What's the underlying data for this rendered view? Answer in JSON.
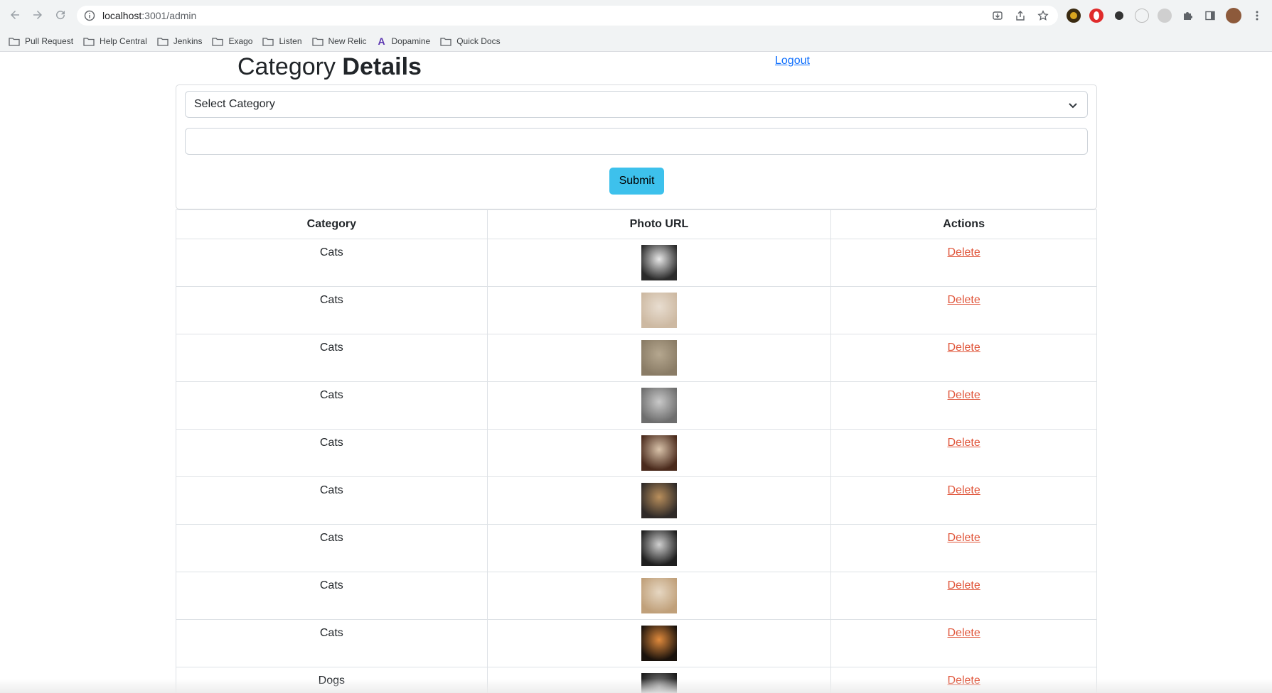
{
  "browser": {
    "url_host": "localhost",
    "url_path": ":3001/admin",
    "bookmarks": [
      {
        "label": "Pull Request",
        "icon": "folder-icon"
      },
      {
        "label": "Help Central",
        "icon": "folder-icon"
      },
      {
        "label": "Jenkins",
        "icon": "folder-icon"
      },
      {
        "label": "Exago",
        "icon": "folder-icon"
      },
      {
        "label": "Listen",
        "icon": "folder-icon"
      },
      {
        "label": "New Relic",
        "icon": "folder-icon"
      },
      {
        "label": "Dopamine",
        "icon": "a-logo-icon"
      },
      {
        "label": "Quick Docs",
        "icon": "folder-icon"
      }
    ]
  },
  "page": {
    "title_regular": "Category",
    "title_bold": "Details",
    "logout_label": "Logout"
  },
  "form": {
    "select_value": "Select Category",
    "input_value": "",
    "submit_label": "Submit"
  },
  "table": {
    "headers": [
      "Category",
      "Photo URL",
      "Actions"
    ],
    "rows": [
      {
        "category": "Cats",
        "action": "Delete",
        "thumb_colors": [
          "#2b2b2b",
          "#e8e8e8"
        ]
      },
      {
        "category": "Cats",
        "action": "Delete",
        "thumb_colors": [
          "#cdb9a2",
          "#e8ddd0"
        ]
      },
      {
        "category": "Cats",
        "action": "Delete",
        "thumb_colors": [
          "#8a7c66",
          "#b5a78f"
        ]
      },
      {
        "category": "Cats",
        "action": "Delete",
        "thumb_colors": [
          "#6e6e6e",
          "#c9c9c9"
        ]
      },
      {
        "category": "Cats",
        "action": "Delete",
        "thumb_colors": [
          "#4a2a1c",
          "#d9c3aa"
        ]
      },
      {
        "category": "Cats",
        "action": "Delete",
        "thumb_colors": [
          "#2f2a28",
          "#b98f5c"
        ]
      },
      {
        "category": "Cats",
        "action": "Delete",
        "thumb_colors": [
          "#1f1f1f",
          "#d0d0d0"
        ]
      },
      {
        "category": "Cats",
        "action": "Delete",
        "thumb_colors": [
          "#c0a07a",
          "#e6d7c2"
        ]
      },
      {
        "category": "Cats",
        "action": "Delete",
        "thumb_colors": [
          "#1a120c",
          "#e08a3c"
        ]
      },
      {
        "category": "Dogs",
        "action": "Delete",
        "thumb_colors": [
          "#1b1b1b",
          "#8a8a8a"
        ]
      }
    ]
  },
  "colors": {
    "link_blue": "#0d6efd",
    "delete_red": "#e0553a",
    "submit_cyan": "#3dc1ec"
  }
}
